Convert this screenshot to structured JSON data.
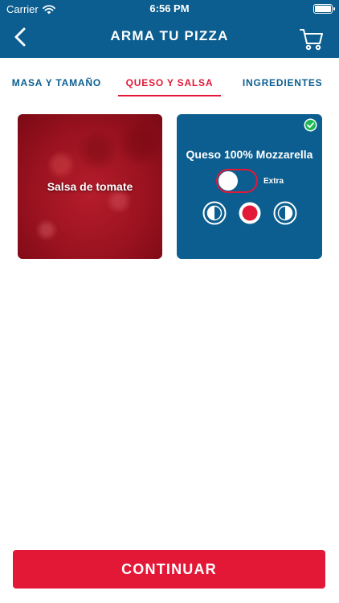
{
  "status_bar": {
    "carrier": "Carrier",
    "time": "6:56 PM"
  },
  "header": {
    "title": "ARMA TU PIZZA",
    "back_icon": "chevron-left-icon",
    "cart_icon": "shopping-cart-icon"
  },
  "tabs": [
    {
      "label": "MASA Y TAMAÑO",
      "active": false
    },
    {
      "label": "QUESO Y SALSA",
      "active": true
    },
    {
      "label": "INGREDIENTES",
      "active": false
    }
  ],
  "options": {
    "sauce": {
      "label": "Salsa de tomate"
    },
    "cheese": {
      "label": "Queso 100% Mozzarella",
      "extra_label": "Extra",
      "extra_enabled": false,
      "selected": true,
      "portion_selected": "whole"
    }
  },
  "footer": {
    "continue_label": "CONTINUAR"
  },
  "colors": {
    "brand_blue": "#0b5e8f",
    "brand_red": "#e31837",
    "check_green": "#1db954"
  }
}
